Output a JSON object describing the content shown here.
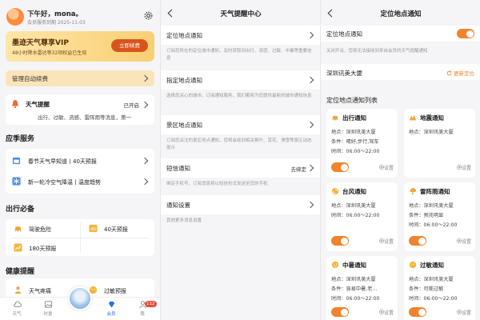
{
  "screen1": {
    "greeting": "下午好，mona。",
    "member_expiry": "会员服务到期 2025-11-03",
    "vip": {
      "title": "墨迹天气尊享VIP",
      "subtitle": "48小时降水雷达等32项权益已生效",
      "button": "立即续费"
    },
    "auto_renew": "管理自动续费",
    "warning": {
      "title": "天气提醒",
      "status": "已开启",
      "desc": "出行、过敏、流感、雷阵雨等消息，第一"
    },
    "emergency": {
      "title": "应季服务",
      "items": [
        {
          "icon": "calendar-icon",
          "label": "春节天气早知道丨40天预报"
        },
        {
          "icon": "snowflake-icon",
          "label": "新一轮冷空气降温丨温度趋势"
        }
      ]
    },
    "travel": {
      "title": "出行必备",
      "items": [
        {
          "icon": "car-icon",
          "label": "驾驶危险"
        },
        {
          "icon": "forty-days-icon",
          "label": "40天预报"
        },
        {
          "icon": "chart-icon",
          "label": "180天预报"
        }
      ]
    },
    "health": {
      "title": "健康提醒",
      "items": [
        {
          "icon": "person-icon",
          "label": "天气疼痛"
        },
        {
          "icon": "allergy-icon",
          "label": "过敏预报"
        }
      ]
    },
    "tabs": [
      {
        "label": "天气",
        "active": false
      },
      {
        "label": "时景",
        "active": false
      },
      {
        "label": "",
        "active": false
      },
      {
        "label": "会员",
        "active": true
      },
      {
        "label": "我",
        "active": false
      }
    ],
    "badge": "112",
    "colors": {
      "accent": "#d9541c",
      "vip_bg": "#f9cf73",
      "tab_active": "#2a6ee8"
    }
  },
  "screen2": {
    "title": "天气提醒中心",
    "settings": [
      {
        "title": "定位地点通知",
        "value": "",
        "desc": "订阅您所在的定位城市通知，及时获取到出行、流感、过敏、中暑等重要信息"
      },
      {
        "title": "指定地点通知",
        "value": "",
        "desc": "选择您关心的城市，订阅通知服务，我们都将为您提供最新的城市通知信息"
      },
      {
        "title": "景区地点通知",
        "value": "",
        "desc": "订阅您关注的景区地点通知，您将会收到相关枫叶、赏花、滑雪等景区动态提示"
      },
      {
        "title": "短信通知",
        "value": "去绑定",
        "desc": "绑定手机号，订阅消息将以短信形式发送至您的手机"
      },
      {
        "title": "通知设置",
        "value": "",
        "desc": "其他更多消息设置"
      }
    ]
  },
  "screen3": {
    "title": "定位地点通知",
    "toggle_label": "定位地点通知",
    "toggle_desc": "关闭开关，您将无法接收到来自会员的天气提醒通知",
    "location": "深圳讯美大厦",
    "refresh": "更新定位",
    "list_title": "定位地点通知列表",
    "cards": [
      {
        "icon": "car-icon",
        "title": "出行通知",
        "lines": [
          "地点：深圳讯美大厦",
          "条件：晴好,步行,驾车",
          "时间：06:00～22:00"
        ],
        "toggle": true,
        "settings": "设置"
      },
      {
        "icon": "earthquake-icon",
        "title": "地震通知",
        "lines": [
          "地点：深圳讯美大厦"
        ],
        "toggle": false,
        "settings": "设置"
      },
      {
        "icon": "typhoon-icon",
        "title": "台风通知",
        "lines": [
          "地点：深圳讯美大厦",
          "时间：06:00～22:00"
        ],
        "toggle": true,
        "settings": "设置"
      },
      {
        "icon": "thunder-icon",
        "title": "雷阵雨通知",
        "lines": [
          "地点：深圳讯美大厦",
          "条件：预兆明显",
          "时间：06:00～22:00"
        ],
        "toggle": true,
        "settings": "设置"
      },
      {
        "icon": "heatstroke-icon",
        "title": "中暑通知",
        "lines": [
          "地点：深圳讯美大厦",
          "条件：容易中暑,老...",
          "时间：06:00～22:00"
        ],
        "toggle": true,
        "settings": "设置"
      },
      {
        "icon": "allergy-icon",
        "title": "过敏通知",
        "lines": [
          "地点：深圳讯美大厦",
          "条件：可能过敏",
          "时间：06:00～22:00"
        ],
        "toggle": true,
        "settings": "设置"
      }
    ],
    "colors": {
      "toggle_on": "#f0832d"
    }
  }
}
